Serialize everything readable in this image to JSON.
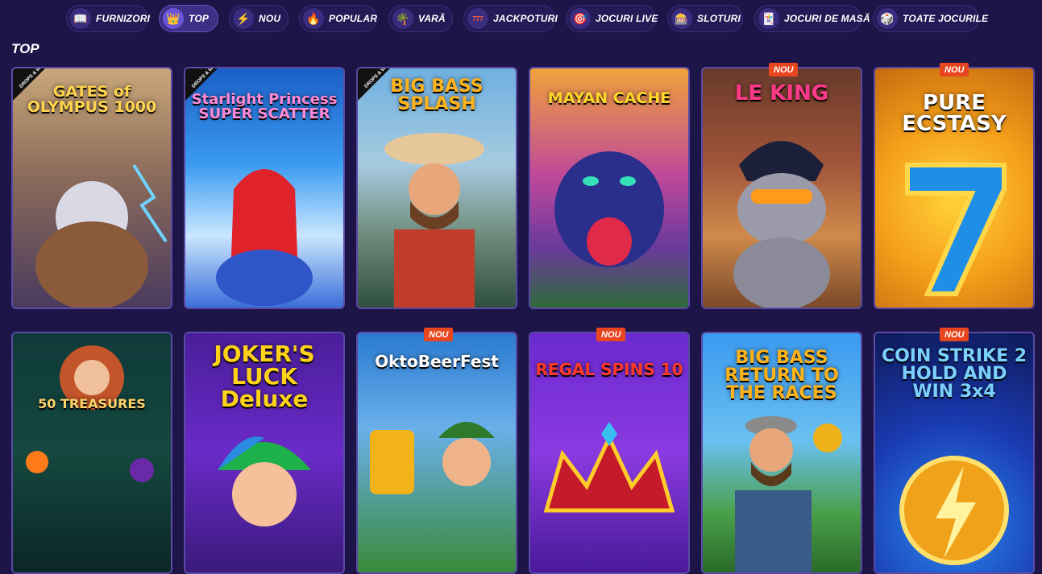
{
  "nav": [
    {
      "label": "FURNIZORI",
      "icon": "book-icon",
      "active": false
    },
    {
      "label": "TOP",
      "icon": "crown-icon",
      "active": true
    },
    {
      "label": "NOU",
      "icon": "lightning-icon",
      "active": false
    },
    {
      "label": "POPULAR",
      "icon": "torch-icon",
      "active": false
    },
    {
      "label": "VARĂ",
      "icon": "palm-tree-icon",
      "active": false
    },
    {
      "label": "JACKPOTURI",
      "icon": "jackpot-777-icon",
      "active": false
    },
    {
      "label": "JOCURI LIVE",
      "icon": "roulette-icon",
      "active": false
    },
    {
      "label": "SLOTURI",
      "icon": "slot-machine-icon",
      "active": false
    },
    {
      "label": "JOCURI DE MASĂ",
      "icon": "cards-icon",
      "active": false
    },
    {
      "label": "TOATE JOCURILE",
      "icon": "dice-icon",
      "active": false
    }
  ],
  "section": {
    "title": "TOP"
  },
  "badges": {
    "new": "NOU"
  },
  "corner_label": "DROPS & WINS",
  "games": [
    {
      "title": "GATES of OLYMPUS 1000",
      "new": false,
      "drops": true
    },
    {
      "title": "Starlight Princess SUPER SCATTER",
      "new": false,
      "drops": true
    },
    {
      "title": "BIG BASS SPLASH",
      "new": false,
      "drops": true
    },
    {
      "title": "MAYAN CACHE",
      "new": false,
      "drops": false
    },
    {
      "title": "LE KING",
      "new": true,
      "drops": false
    },
    {
      "title": "PURE ECSTASY",
      "new": true,
      "drops": false
    },
    {
      "title": "50 TREASURES",
      "new": false,
      "drops": false
    },
    {
      "title": "JOKER'S LUCK Deluxe",
      "new": false,
      "drops": false
    },
    {
      "title": "OktoBeerFest",
      "new": true,
      "drops": false
    },
    {
      "title": "REGAL SPINS 10",
      "new": true,
      "drops": false
    },
    {
      "title": "BIG BASS RETURN TO THE RACES",
      "new": false,
      "drops": false
    },
    {
      "title": "COIN STRIKE 2 HOLD AND WIN 3x4",
      "new": true,
      "drops": false
    }
  ]
}
